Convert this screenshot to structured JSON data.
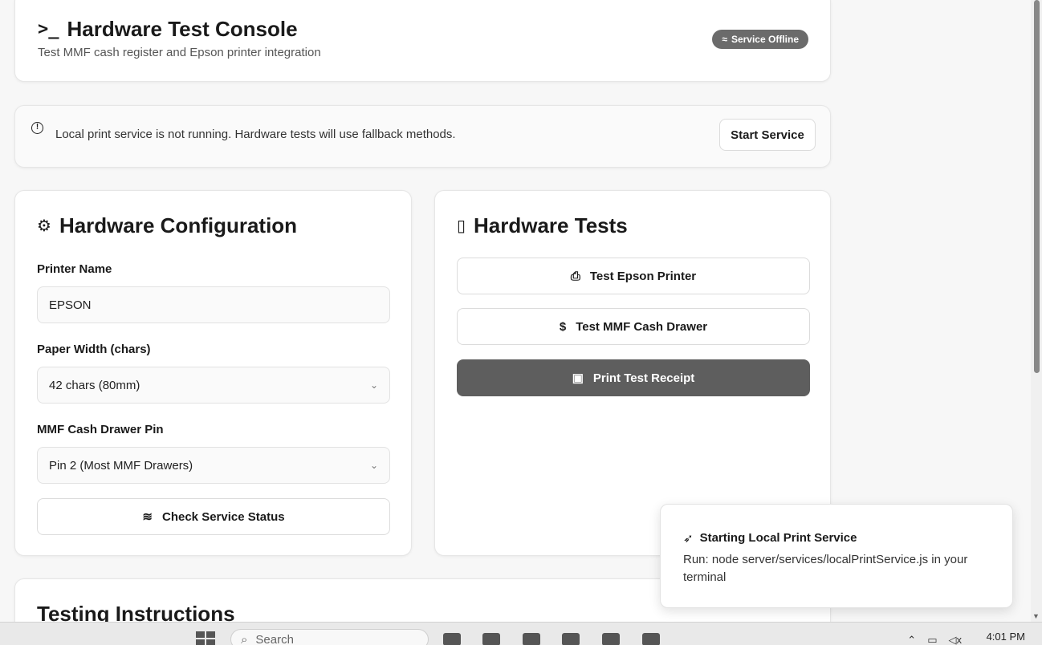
{
  "header": {
    "title": "Hardware Test Console",
    "subtitle": "Test MMF cash register and Epson printer integration",
    "status_badge": "Service Offline"
  },
  "alert": {
    "message": "Local print service is not running. Hardware tests will use fallback methods.",
    "button_label": "Start Service"
  },
  "configuration": {
    "title": "Hardware Configuration",
    "printer_name_label": "Printer Name",
    "printer_name_value": "EPSON",
    "paper_width_label": "Paper Width (chars)",
    "paper_width_value": "42 chars (80mm)",
    "cash_drawer_pin_label": "MMF Cash Drawer Pin",
    "cash_drawer_pin_value": "Pin 2 (Most MMF Drawers)",
    "check_status_label": "Check Service Status"
  },
  "tests": {
    "title": "Hardware Tests",
    "buttons": [
      {
        "label": "Test Epson Printer",
        "icon": "printer-icon"
      },
      {
        "label": "Test MMF Cash Drawer",
        "icon": "dollar-icon"
      },
      {
        "label": "Print Test Receipt",
        "icon": "receipt-icon"
      }
    ]
  },
  "instructions": {
    "title": "Testing Instructions"
  },
  "toast": {
    "title": "Starting Local Print Service",
    "body": "Run: node server/services/localPrintService.js in your terminal"
  },
  "taskbar": {
    "search_placeholder": "Search",
    "time": "4:01 PM"
  },
  "colors": {
    "primary_button": "#5e5e5e",
    "badge": "#6b6b6b",
    "background": "#f7f7f7"
  }
}
